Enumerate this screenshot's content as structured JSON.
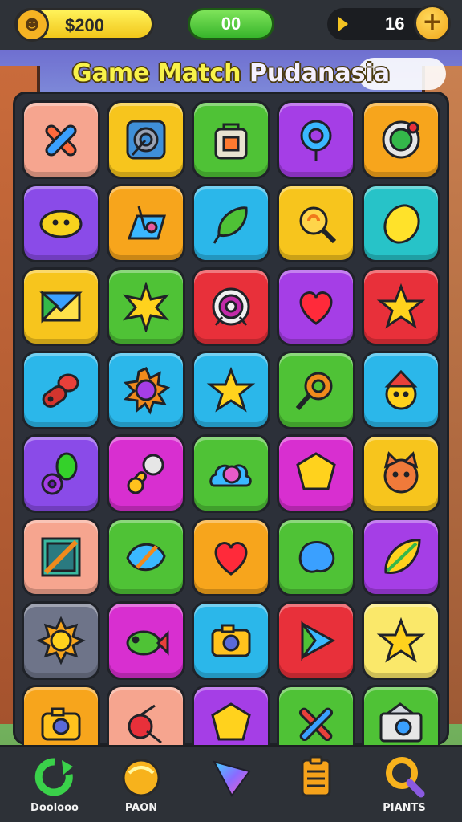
{
  "topbar": {
    "coins": "$200",
    "score": "00",
    "lives": "16"
  },
  "title": {
    "part1": "Game Match ",
    "part2": "Pudanasia"
  },
  "board": {
    "tiles": [
      {
        "color": "#f6a58f",
        "icon": "bandage-x-icon"
      },
      {
        "color": "#f7c51d",
        "icon": "target-screen-icon"
      },
      {
        "color": "#4fc236",
        "icon": "bag-icon"
      },
      {
        "color": "#a53ee6",
        "icon": "pin-icon"
      },
      {
        "color": "#f7a51c",
        "icon": "chat-bubble-icon"
      },
      {
        "color": "#8a4be8",
        "icon": "lemon-face-icon"
      },
      {
        "color": "#f7a51c",
        "icon": "tool-box-icon"
      },
      {
        "color": "#2bb7ea",
        "icon": "leaf-icon"
      },
      {
        "color": "#f7c51d",
        "icon": "magnifier-swirl-icon"
      },
      {
        "color": "#27c3c8",
        "icon": "lemon-icon"
      },
      {
        "color": "#f7c51d",
        "icon": "envelope-icon"
      },
      {
        "color": "#4fc236",
        "icon": "sun-burst-icon"
      },
      {
        "color": "#e8303a",
        "icon": "target-icon"
      },
      {
        "color": "#a53ee6",
        "icon": "heart-icon"
      },
      {
        "color": "#e8303a",
        "icon": "star-icon"
      },
      {
        "color": "#2bb7ea",
        "icon": "drumstick-icon"
      },
      {
        "color": "#2bb7ea",
        "icon": "gear-sun-icon"
      },
      {
        "color": "#2bb7ea",
        "icon": "star-icon"
      },
      {
        "color": "#4fc236",
        "icon": "magnifier-icon"
      },
      {
        "color": "#2bb7ea",
        "icon": "smiley-hat-icon"
      },
      {
        "color": "#8a4be8",
        "icon": "pea-pod-icon"
      },
      {
        "color": "#d82fd0",
        "icon": "rattle-icon"
      },
      {
        "color": "#4fc236",
        "icon": "cloud-icon"
      },
      {
        "color": "#d82fd0",
        "icon": "star-gem-icon"
      },
      {
        "color": "#f7c51d",
        "icon": "cat-face-icon"
      },
      {
        "color": "#f6a58f",
        "icon": "picture-frame-icon"
      },
      {
        "color": "#4fc236",
        "icon": "leaf-pen-icon"
      },
      {
        "color": "#f7a51c",
        "icon": "heart-icon"
      },
      {
        "color": "#4fc236",
        "icon": "blob-icon"
      },
      {
        "color": "#a53ee6",
        "icon": "feather-leaf-icon"
      },
      {
        "color": "#6e7489",
        "icon": "sun-face-icon"
      },
      {
        "color": "#d82fd0",
        "icon": "fish-icon"
      },
      {
        "color": "#2bb7ea",
        "icon": "camera-icon"
      },
      {
        "color": "#e8303a",
        "icon": "play-icon"
      },
      {
        "color": "#fae86a",
        "icon": "star-icon"
      },
      {
        "color": "#f7a51c",
        "icon": "camera-icon"
      },
      {
        "color": "#f6a58f",
        "icon": "cherry-icon"
      },
      {
        "color": "#a53ee6",
        "icon": "star-gem-icon"
      },
      {
        "color": "#4fc236",
        "icon": "crossed-tools-icon"
      },
      {
        "color": "#4fc236",
        "icon": "camera-box-icon"
      }
    ]
  },
  "nav": {
    "items": [
      {
        "label": "Doolooo",
        "icon": "refresh-icon"
      },
      {
        "label": "PAON",
        "icon": "coin-pot-icon"
      },
      {
        "label": "",
        "icon": "gem-play-icon"
      },
      {
        "label": "",
        "icon": "clipboard-icon"
      },
      {
        "label": "PIANTS",
        "icon": "search-icon"
      }
    ]
  }
}
